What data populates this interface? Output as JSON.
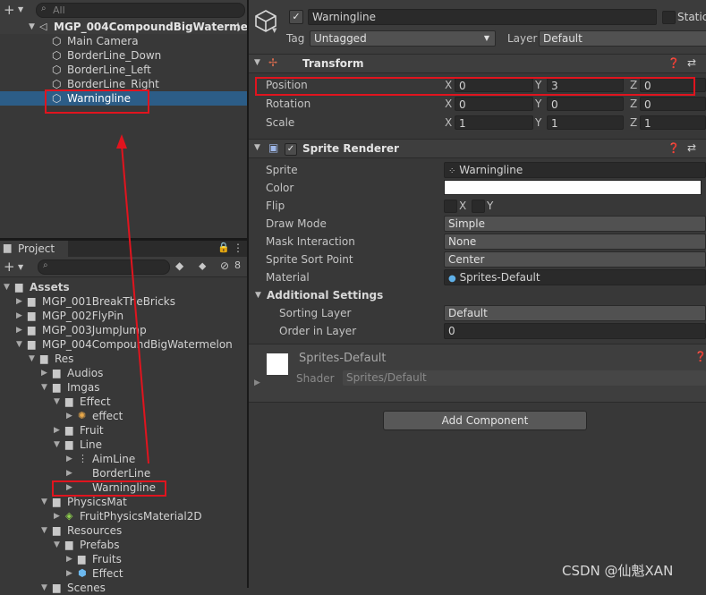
{
  "hierarchy": {
    "search_placeholder": "All",
    "scene": "MGP_004CompoundBigWaterme",
    "items": [
      "Main Camera",
      "BorderLine_Down",
      "BorderLine_Left",
      "BorderLine_Right",
      "Warningline"
    ]
  },
  "project": {
    "tab": "Project",
    "hidden_count": "8",
    "tree": [
      {
        "label": "Assets",
        "depth": 0,
        "open": true
      },
      {
        "label": "MGP_001BreakTheBricks",
        "depth": 1,
        "open": false
      },
      {
        "label": "MGP_002FlyPin",
        "depth": 1,
        "open": false
      },
      {
        "label": "MGP_003JumpJump",
        "depth": 1,
        "open": false
      },
      {
        "label": "MGP_004CompoundBigWatermelon",
        "depth": 1,
        "open": true
      },
      {
        "label": "Res",
        "depth": 2,
        "open": true
      },
      {
        "label": "Audios",
        "depth": 3,
        "open": false
      },
      {
        "label": "Imgas",
        "depth": 3,
        "open": true
      },
      {
        "label": "Effect",
        "depth": 4,
        "open": true
      },
      {
        "label": "effect",
        "depth": 5,
        "open": false,
        "icon": "particle"
      },
      {
        "label": "Fruit",
        "depth": 4,
        "open": false
      },
      {
        "label": "Line",
        "depth": 4,
        "open": true
      },
      {
        "label": "AimLine",
        "depth": 5,
        "open": false,
        "icon": "sprite-dots"
      },
      {
        "label": "BorderLine",
        "depth": 5,
        "open": false,
        "icon": "none"
      },
      {
        "label": "Warningline",
        "depth": 5,
        "open": false,
        "icon": "none"
      },
      {
        "label": "PhysicsMat",
        "depth": 3,
        "open": true
      },
      {
        "label": "FruitPhysicsMaterial2D",
        "depth": 4,
        "open": false,
        "icon": "physmat"
      },
      {
        "label": "Resources",
        "depth": 3,
        "open": true
      },
      {
        "label": "Prefabs",
        "depth": 4,
        "open": true
      },
      {
        "label": "Fruits",
        "depth": 5,
        "open": false
      },
      {
        "label": "Effect",
        "depth": 5,
        "open": false,
        "icon": "prefab"
      },
      {
        "label": "Scenes",
        "depth": 3,
        "open": true
      }
    ]
  },
  "inspector": {
    "object_name": "Warningline",
    "static_label": "Static",
    "tag_label": "Tag",
    "tag_value": "Untagged",
    "layer_label": "Layer",
    "layer_value": "Default",
    "transform": {
      "title": "Transform",
      "position_label": "Position",
      "rotation_label": "Rotation",
      "scale_label": "Scale",
      "x": "X",
      "y": "Y",
      "z": "Z",
      "position": [
        "0",
        "3",
        "0"
      ],
      "rotation": [
        "0",
        "0",
        "0"
      ],
      "scale": [
        "1",
        "1",
        "1"
      ]
    },
    "sprite_renderer": {
      "title": "Sprite Renderer",
      "sprite_label": "Sprite",
      "sprite_value": "Warningline",
      "color_label": "Color",
      "flip_label": "Flip",
      "flip_x": "X",
      "flip_y": "Y",
      "draw_mode_label": "Draw Mode",
      "draw_mode_value": "Simple",
      "mask_label": "Mask Interaction",
      "mask_value": "None",
      "sort_point_label": "Sprite Sort Point",
      "sort_point_value": "Center",
      "material_label": "Material",
      "material_value": "Sprites-Default",
      "additional_label": "Additional Settings",
      "sorting_layer_label": "Sorting Layer",
      "sorting_layer_value": "Default",
      "order_label": "Order in Layer",
      "order_value": "0"
    },
    "material": {
      "name": "Sprites-Default",
      "shader_label": "Shader",
      "shader_value": "Sprites/Default"
    },
    "add_component": "Add Component"
  },
  "watermark": "CSDN @仙魁XAN",
  "colors": {
    "highlight": "#e0141e",
    "selection": "#2c5d87"
  }
}
